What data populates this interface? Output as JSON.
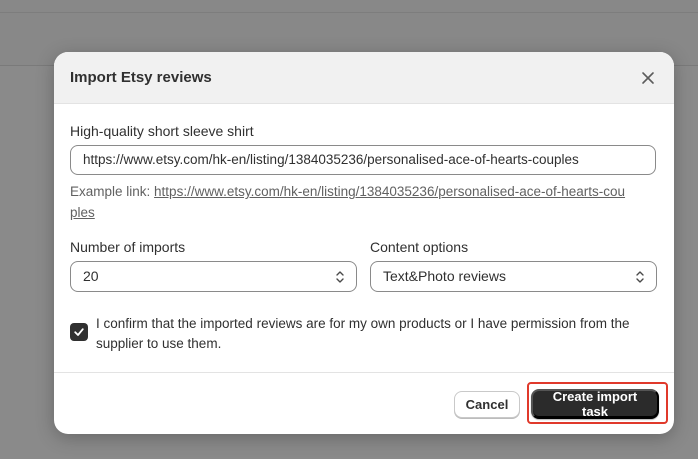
{
  "dialog": {
    "title": "Import Etsy reviews"
  },
  "product": {
    "name": "High-quality short sleeve shirt",
    "url_value": "https://www.etsy.com/hk-en/listing/1384035236/personalised-ace-of-hearts-couples",
    "example_prefix": "Example link: ",
    "example_link": "https://www.etsy.com/hk-en/listing/1384035236/personalised-ace-of-hearts-couples"
  },
  "imports": {
    "label": "Number of imports",
    "value": "20"
  },
  "content": {
    "label": "Content options",
    "value": "Text&Photo reviews"
  },
  "confirm": {
    "checked": true,
    "text": "I confirm that the imported reviews are for my own products or I have permission from the supplier to use them."
  },
  "footer": {
    "cancel_label": "Cancel",
    "create_label": "Create import task"
  },
  "colors": {
    "primary_button": "#2b2b2b",
    "highlight": "#e0392b"
  }
}
